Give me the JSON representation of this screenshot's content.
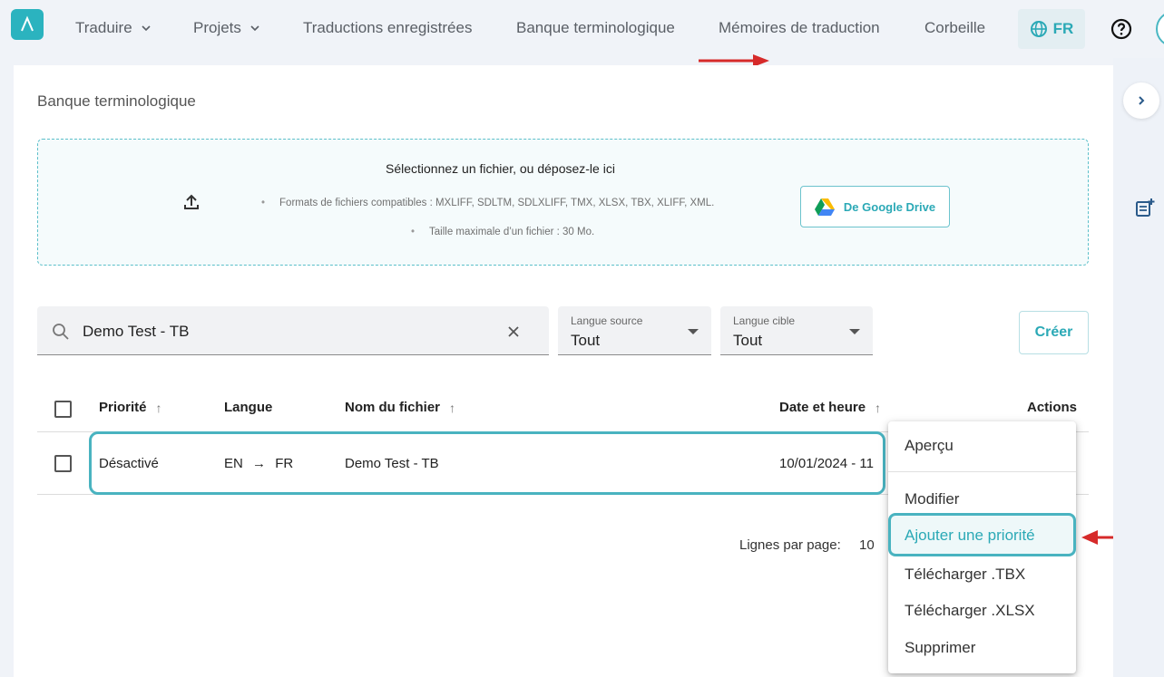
{
  "nav": {
    "items": [
      {
        "label": "Traduire",
        "dropdown": true
      },
      {
        "label": "Projets",
        "dropdown": true
      },
      {
        "label": "Traductions enregistrées"
      },
      {
        "label": "Banque terminologique"
      },
      {
        "label": "Mémoires de traduction"
      },
      {
        "label": "Corbeille"
      }
    ],
    "language": "FR",
    "help_icon": "help-circle-icon",
    "logo_icon": "lambda-logo"
  },
  "page": {
    "title": "Banque terminologique"
  },
  "dropzone": {
    "title": "Sélectionnez un fichier, ou déposez-le ici",
    "formats": "Formats de fichiers compatibles : MXLIFF, SDLTM, SDLXLIFF, TMX, XLSX, TBX, XLIFF, XML.",
    "max_size": "Taille maximale d’un fichier : 30 Mo.",
    "gdrive_label": "De Google Drive"
  },
  "filters": {
    "search_value": "Demo Test - TB",
    "source_label": "Langue source",
    "source_value": "Tout",
    "target_label": "Langue cible",
    "target_value": "Tout",
    "create_label": "Créer"
  },
  "table": {
    "headers": {
      "priority": "Priorité",
      "language": "Langue",
      "filename": "Nom du fichier",
      "datetime": "Date et heure",
      "actions": "Actions"
    },
    "rows": [
      {
        "priority": "Désactivé",
        "source": "EN",
        "target": "FR",
        "filename": "Demo Test - TB",
        "datetime": "10/01/2024 - 11"
      }
    ]
  },
  "pagination": {
    "label": "Lignes par page:",
    "value": "10"
  },
  "action_menu": {
    "items": [
      "Aperçu",
      "Modifier",
      "Ajouter une priorité",
      "Télécharger .TBX",
      "Télécharger .XLSX",
      "Supprimer"
    ],
    "highlighted": "Ajouter une priorité"
  },
  "colors": {
    "accent": "#2ba9b6",
    "highlight": "#49b3c0",
    "annotation": "#d62a2a"
  }
}
